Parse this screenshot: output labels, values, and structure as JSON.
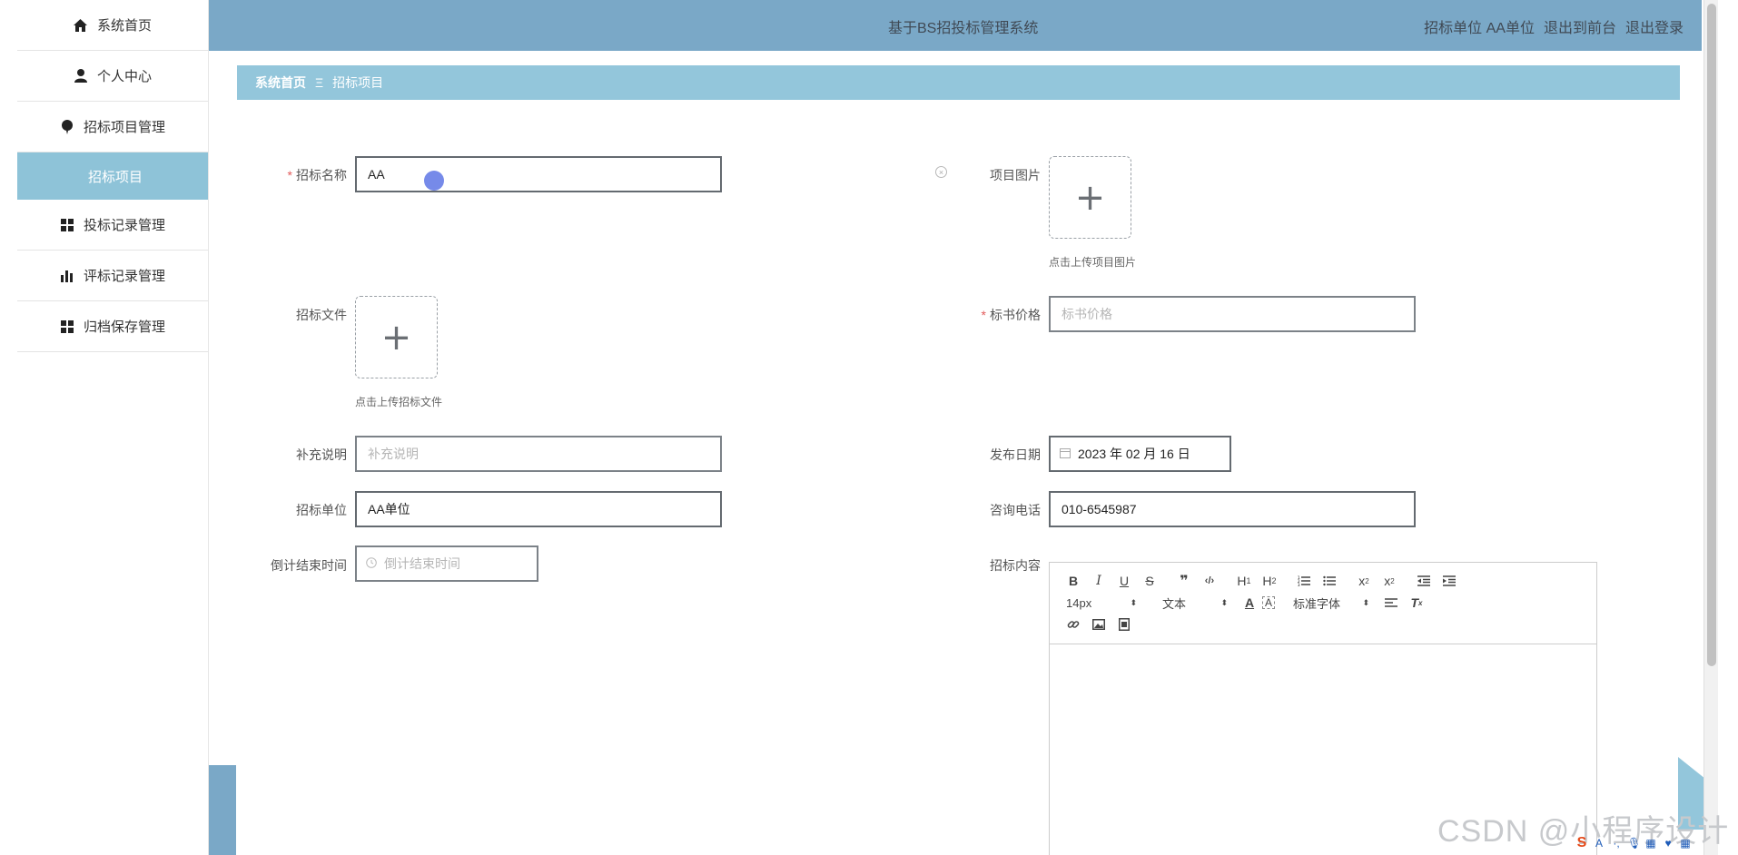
{
  "sidebar": {
    "items": [
      {
        "label": "系统首页",
        "icon": "home-icon"
      },
      {
        "label": "个人中心",
        "icon": "user-icon"
      },
      {
        "label": "招标项目管理",
        "icon": "balloon-icon"
      },
      {
        "label": "招标项目",
        "icon": ""
      },
      {
        "label": "投标记录管理",
        "icon": "grid-icon"
      },
      {
        "label": "评标记录管理",
        "icon": "bar-chart-icon"
      },
      {
        "label": "归档保存管理",
        "icon": "grid-icon"
      }
    ]
  },
  "header": {
    "title": "基于BS招投标管理系统",
    "user": "招标单位 AA单位",
    "front_link": "退出到前台",
    "logout_link": "退出登录"
  },
  "breadcrumb": {
    "home": "系统首页",
    "separator": "Ξ",
    "current": "招标项目"
  },
  "form": {
    "name_label": "招标名称",
    "name_value": "AA",
    "image_label": "项目图片",
    "image_hint": "点击上传项目图片",
    "file_label": "招标文件",
    "file_hint": "点击上传招标文件",
    "price_label": "标书价格",
    "price_placeholder": "标书价格",
    "note_label": "补充说明",
    "note_placeholder": "补充说明",
    "date_label": "发布日期",
    "date_value": "2023 年 02 月 16 日",
    "unit_label": "招标单位",
    "unit_value": "AA单位",
    "phone_label": "咨询电话",
    "phone_value": "010-6545987",
    "countdown_label": "倒计结束时间",
    "countdown_placeholder": "倒计结束时间",
    "content_label": "招标内容"
  },
  "editor": {
    "font_size": "14px",
    "paragraph": "文本",
    "font_family": "标准字体"
  },
  "watermark": "CSDN @小程序设计",
  "colors": {
    "header": "#7aa8c7",
    "breadcrumb": "#93c6db",
    "active_item": "#8ec3d8",
    "required": "#e25b5b"
  }
}
